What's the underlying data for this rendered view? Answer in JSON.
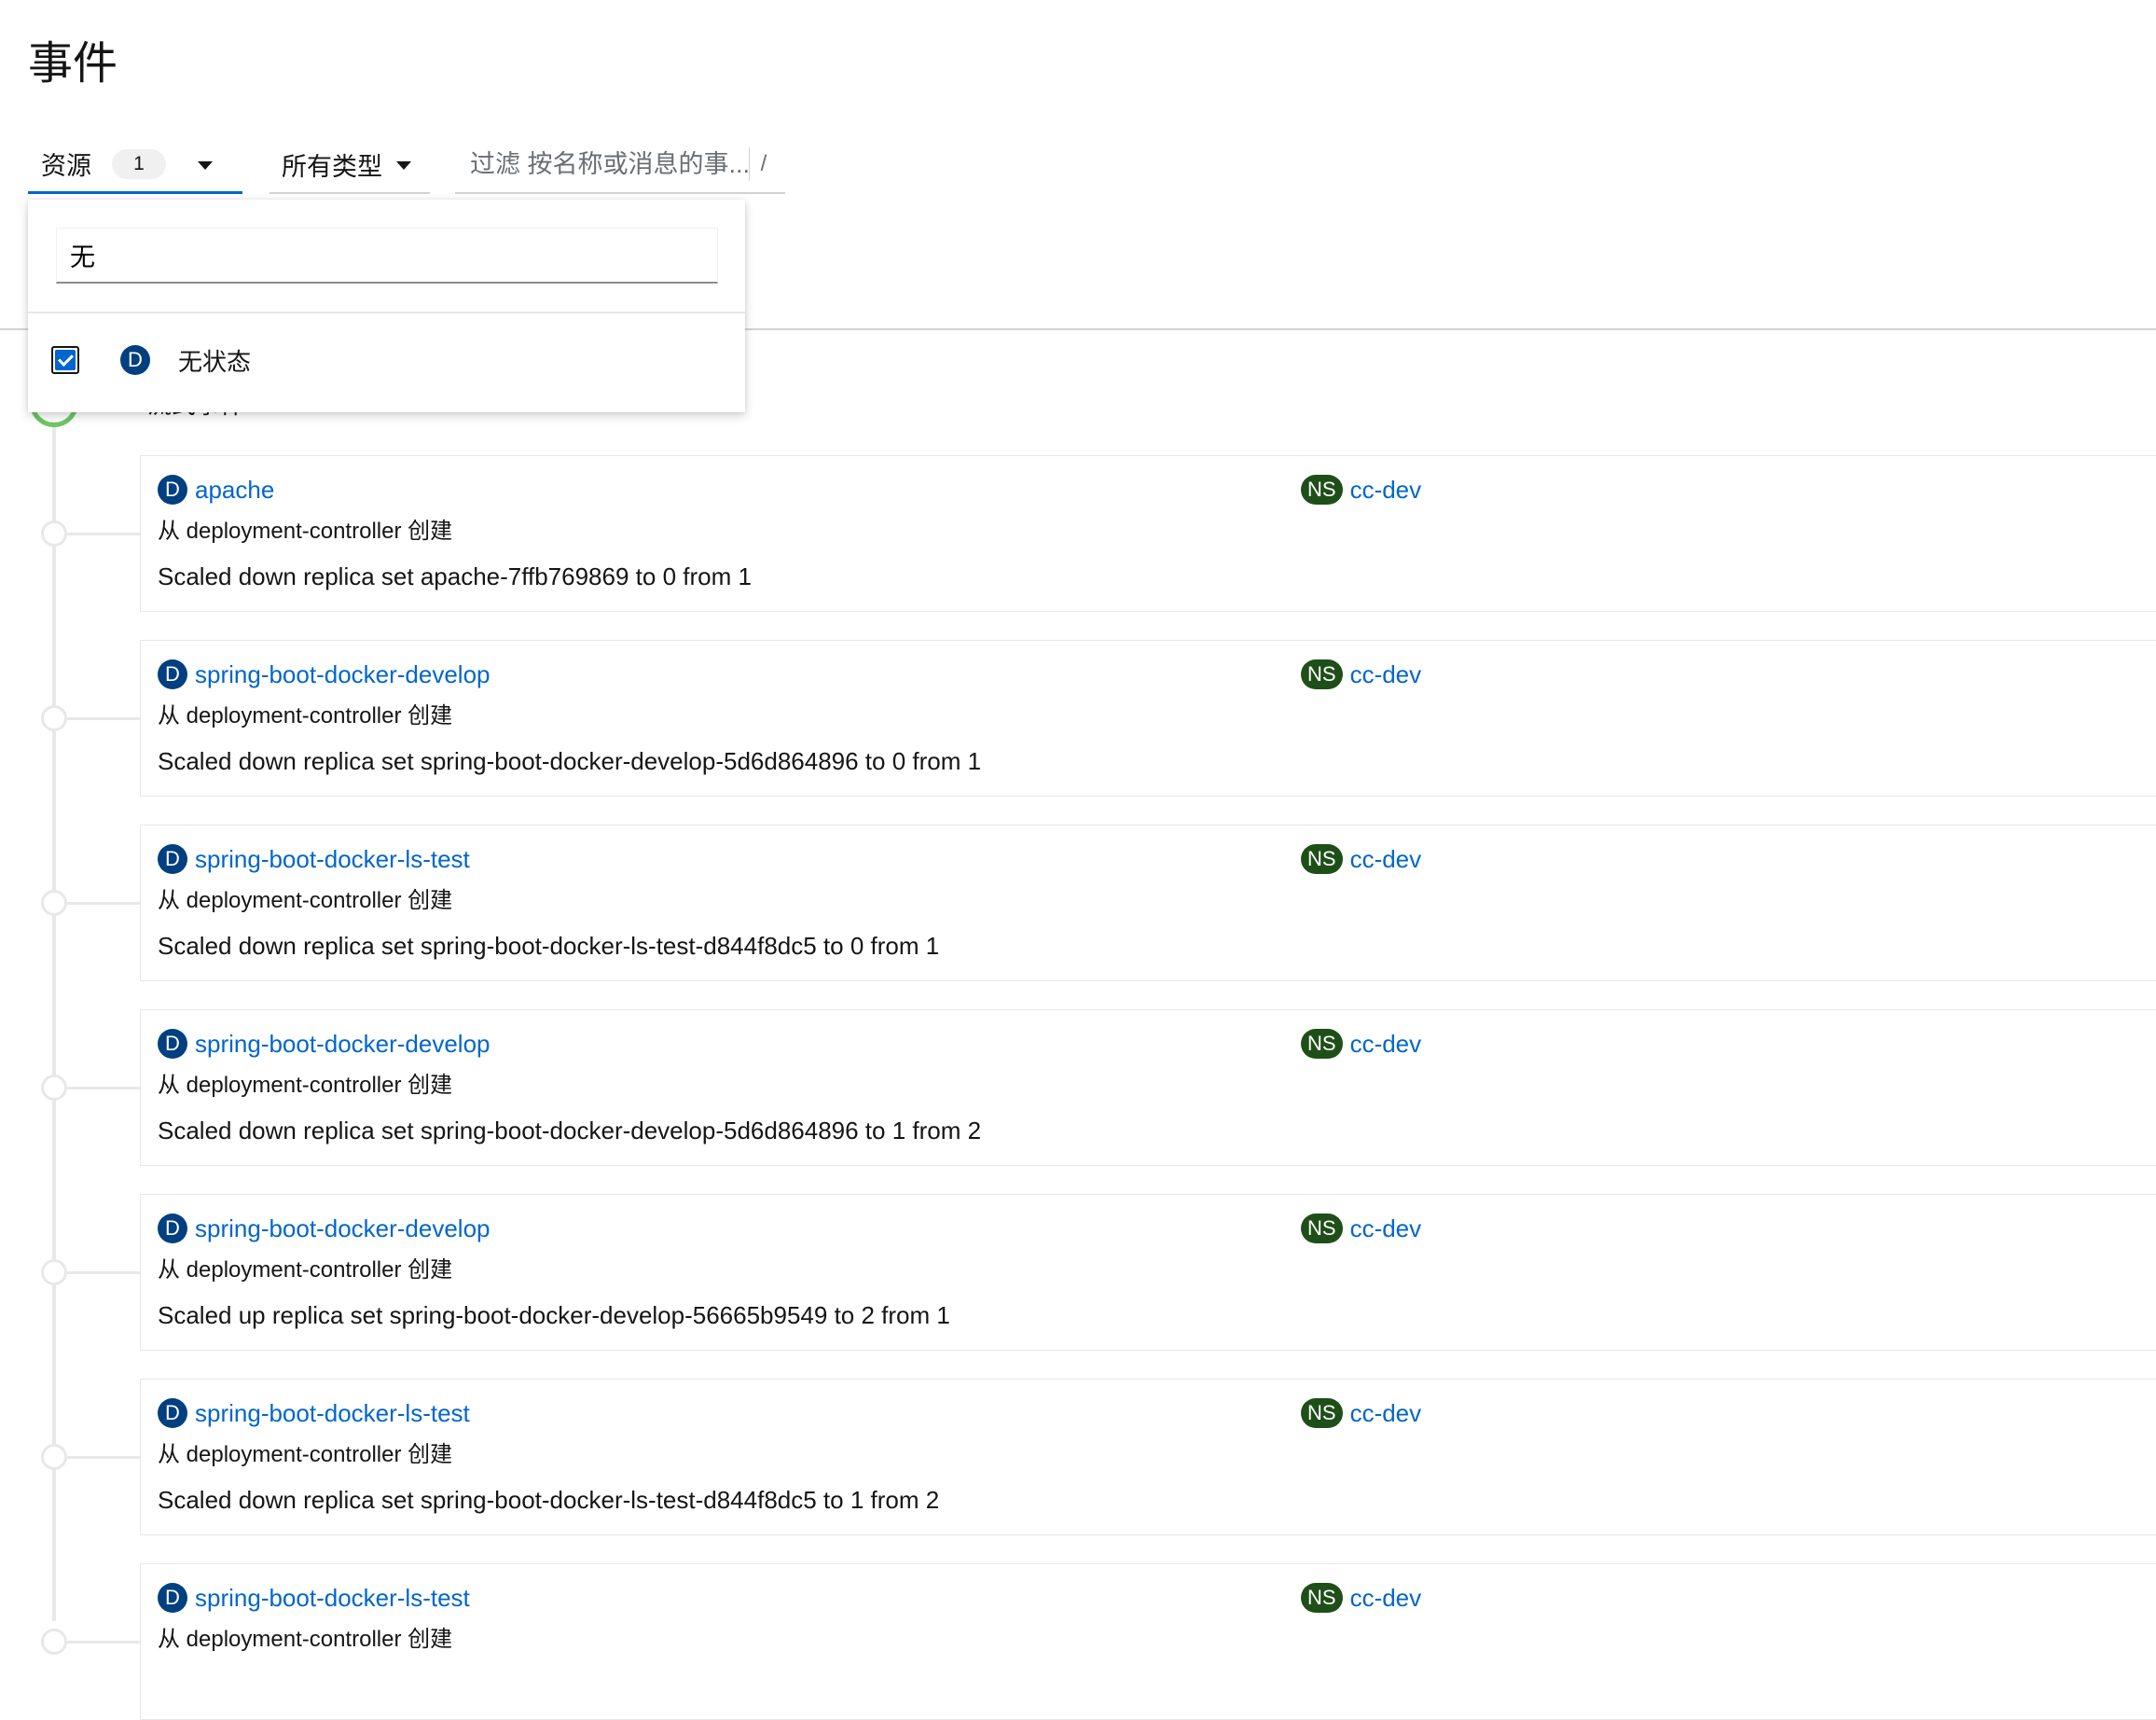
{
  "page": {
    "title": "事件"
  },
  "toolbar": {
    "resource_label": "资源",
    "resource_count": "1",
    "type_label": "所有类型",
    "filter_placeholder": "过滤 按名称或消息的事...",
    "filter_hint": "/"
  },
  "dropdown": {
    "search_value": "无",
    "options": [
      {
        "icon": "D",
        "label": "无状态",
        "checked": true
      }
    ]
  },
  "timeline": {
    "hidden_label": "流式事件"
  },
  "events": [
    {
      "kind": "D",
      "name": "apache",
      "source": "从 deployment-controller 创建",
      "message": "Scaled down replica set apache-7ffb769869 to 0 from 1",
      "ns_badge": "NS",
      "namespace": "cc-dev"
    },
    {
      "kind": "D",
      "name": "spring-boot-docker-develop",
      "source": "从 deployment-controller 创建",
      "message": "Scaled down replica set spring-boot-docker-develop-5d6d864896 to 0 from 1",
      "ns_badge": "NS",
      "namespace": "cc-dev"
    },
    {
      "kind": "D",
      "name": "spring-boot-docker-ls-test",
      "source": "从 deployment-controller 创建",
      "message": "Scaled down replica set spring-boot-docker-ls-test-d844f8dc5 to 0 from 1",
      "ns_badge": "NS",
      "namespace": "cc-dev"
    },
    {
      "kind": "D",
      "name": "spring-boot-docker-develop",
      "source": "从 deployment-controller 创建",
      "message": "Scaled down replica set spring-boot-docker-develop-5d6d864896 to 1 from 2",
      "ns_badge": "NS",
      "namespace": "cc-dev"
    },
    {
      "kind": "D",
      "name": "spring-boot-docker-develop",
      "source": "从 deployment-controller 创建",
      "message": "Scaled up replica set spring-boot-docker-develop-56665b9549 to 2 from 1",
      "ns_badge": "NS",
      "namespace": "cc-dev"
    },
    {
      "kind": "D",
      "name": "spring-boot-docker-ls-test",
      "source": "从 deployment-controller 创建",
      "message": "Scaled down replica set spring-boot-docker-ls-test-d844f8dc5 to 1 from 2",
      "ns_badge": "NS",
      "namespace": "cc-dev"
    },
    {
      "kind": "D",
      "name": "spring-boot-docker-ls-test",
      "source": "从 deployment-controller 创建",
      "message": "",
      "ns_badge": "NS",
      "namespace": "cc-dev"
    }
  ]
}
